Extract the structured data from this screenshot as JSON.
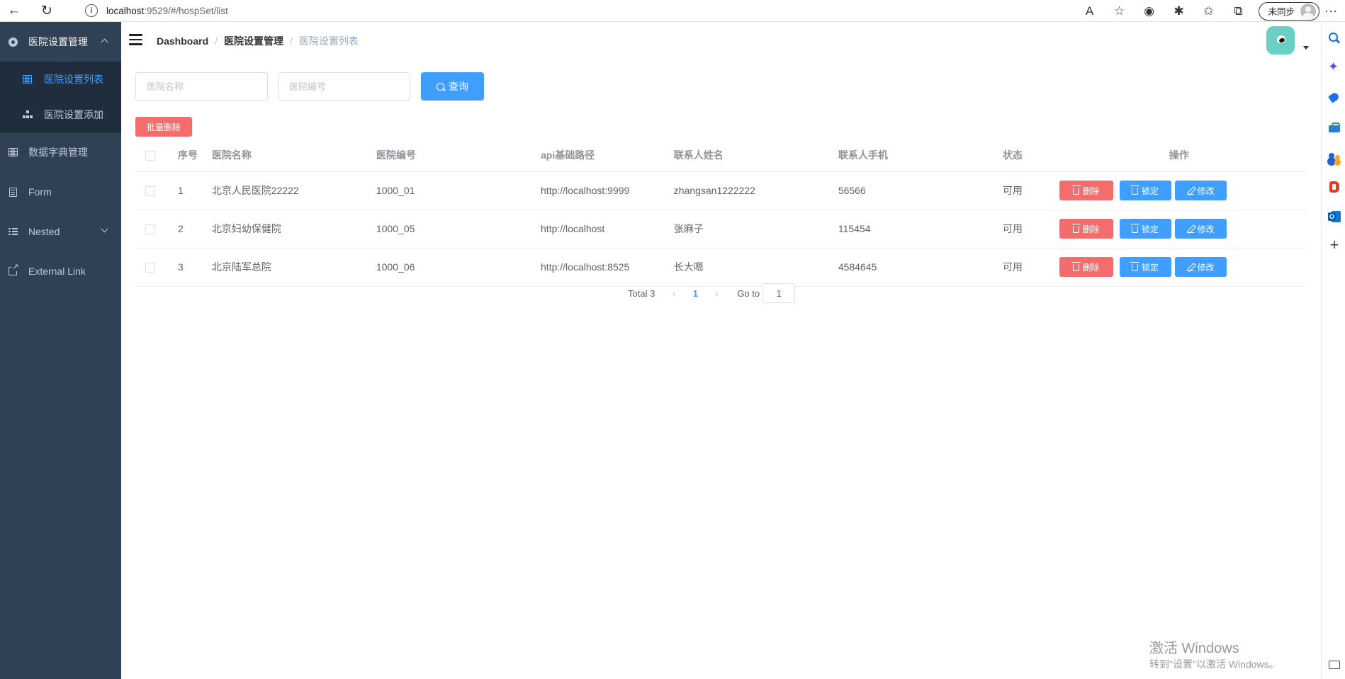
{
  "browser": {
    "url_host": "localhost",
    "url_path": ":9529/#/hospSet/list",
    "sync_label": "未同步",
    "more": "···"
  },
  "sidebar": {
    "group_title": "医院设置管理",
    "sub_items": [
      {
        "label": "医院设置列表",
        "active": true
      },
      {
        "label": "医院设置添加",
        "active": false
      }
    ],
    "items": [
      {
        "label": "数据字典管理"
      },
      {
        "label": "Form"
      },
      {
        "label": "Nested"
      },
      {
        "label": "External Link"
      }
    ]
  },
  "breadcrumb": [
    "Dashboard",
    "医院设置管理",
    "医院设置列表"
  ],
  "search": {
    "name_placeholder": "医院名称",
    "code_placeholder": "医院编号",
    "button_label": "查询"
  },
  "batch_delete_label": "批量删除",
  "table": {
    "columns": [
      "序号",
      "医院名称",
      "医院编号",
      "api基础路径",
      "联系人姓名",
      "联系人手机",
      "状态",
      "操作"
    ],
    "rows": [
      {
        "index": "1",
        "name": "北京人民医院22222",
        "code": "1000_01",
        "api": "http://localhost:9999",
        "contact": "zhangsan1222222",
        "phone": "56566",
        "status": "可用"
      },
      {
        "index": "2",
        "name": "北京妇幼保健院",
        "code": "1000_05",
        "api": "http://localhost",
        "contact": "张麻子",
        "phone": "115454",
        "status": "可用"
      },
      {
        "index": "3",
        "name": "北京陆军总院",
        "code": "1000_06",
        "api": "http://localhost:8525",
        "contact": "长大嗯",
        "phone": "4584645",
        "status": "可用"
      }
    ],
    "ops": {
      "delete": "删除",
      "lock": "锁定",
      "edit": "修改"
    }
  },
  "pagination": {
    "total": "Total 3",
    "current": "1",
    "goto_label": "Go to",
    "goto_value": "1"
  },
  "watermark": {
    "line1": "激活 Windows",
    "line2": "转到\"设置\"以激活 Windows。"
  },
  "colors": {
    "sidebar_bg": "#304156",
    "primary": "#409eff",
    "danger": "#f56c6c",
    "avatar": "#68d0c5"
  }
}
